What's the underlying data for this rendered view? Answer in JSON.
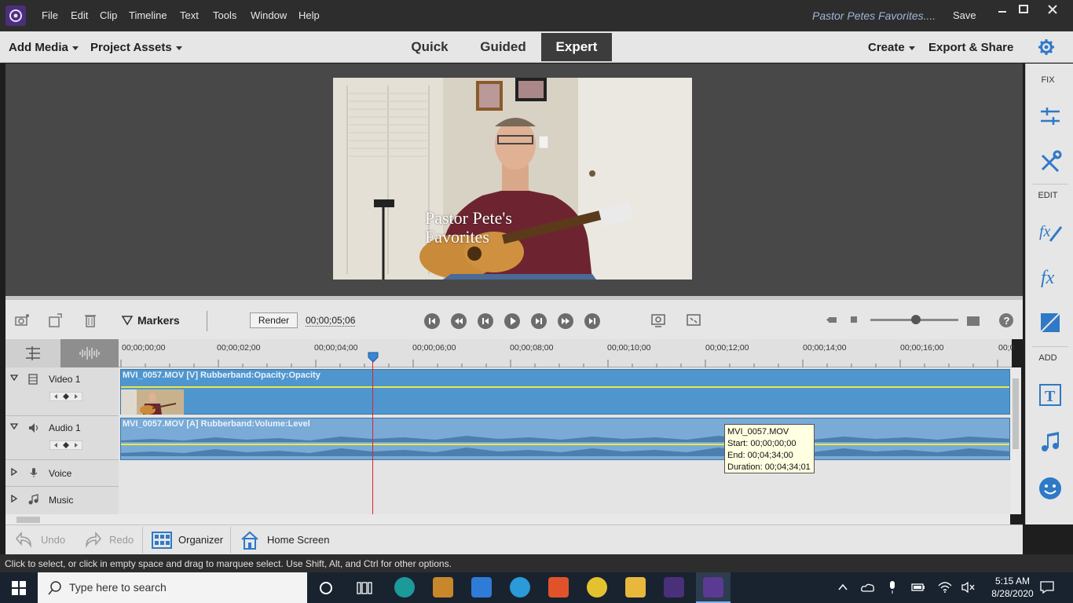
{
  "menubar": {
    "items": [
      "File",
      "Edit",
      "Clip",
      "Timeline",
      "Text",
      "Tools",
      "Window",
      "Help"
    ],
    "project_title": "Pastor Petes Favorites....",
    "save_label": "Save"
  },
  "modebar": {
    "add_media": "Add Media",
    "project_assets": "Project Assets",
    "tabs": [
      "Quick",
      "Guided",
      "Expert"
    ],
    "active_tab": "Expert",
    "create": "Create",
    "export_share": "Export & Share"
  },
  "rightpanel": {
    "fix_label": "FIX",
    "edit_label": "EDIT",
    "add_label": "ADD"
  },
  "monitor": {
    "title_text": "Pastor Pete's\nFavorites"
  },
  "timeline": {
    "markers_label": "Markers",
    "render_label": "Render",
    "timecode": "00;00;05;06",
    "ruler_labels": [
      "00;00;00;00",
      "00;00;02;00",
      "00;00;04;00",
      "00;00;06;00",
      "00;00;08;00",
      "00;00;10;00",
      "00;00;12;00",
      "00;00;14;00",
      "00;00;16;00",
      "00;0"
    ],
    "tracks": {
      "video1": "Video 1",
      "audio1": "Audio 1",
      "voice": "Voice",
      "music": "Music"
    },
    "video_clip_title": "MVI_0057.MOV [V] Rubberband:Opacity:Opacity",
    "audio_clip_title": "MVI_0057.MOV [A] Rubberband:Volume:Level",
    "tooltip": {
      "name": "MVI_0057.MOV",
      "start": "Start: 00;00;00;00",
      "end": "End: 00;04;34;00",
      "duration": "Duration: 00;04;34;01"
    }
  },
  "bottombar": {
    "undo": "Undo",
    "redo": "Redo",
    "organizer": "Organizer",
    "home_screen": "Home Screen"
  },
  "status": "Click to select, or click in empty space and drag to marquee select. Use Shift, Alt, and Ctrl for other options.",
  "taskbar": {
    "search_placeholder": "Type here to search",
    "time": "5:15 AM",
    "date": "8/28/2020"
  },
  "colors": {
    "accent": "#1f6fbf",
    "clip_video": "#4f96cf",
    "clip_audio": "#7aaad6",
    "playhead": "#dd2233"
  }
}
